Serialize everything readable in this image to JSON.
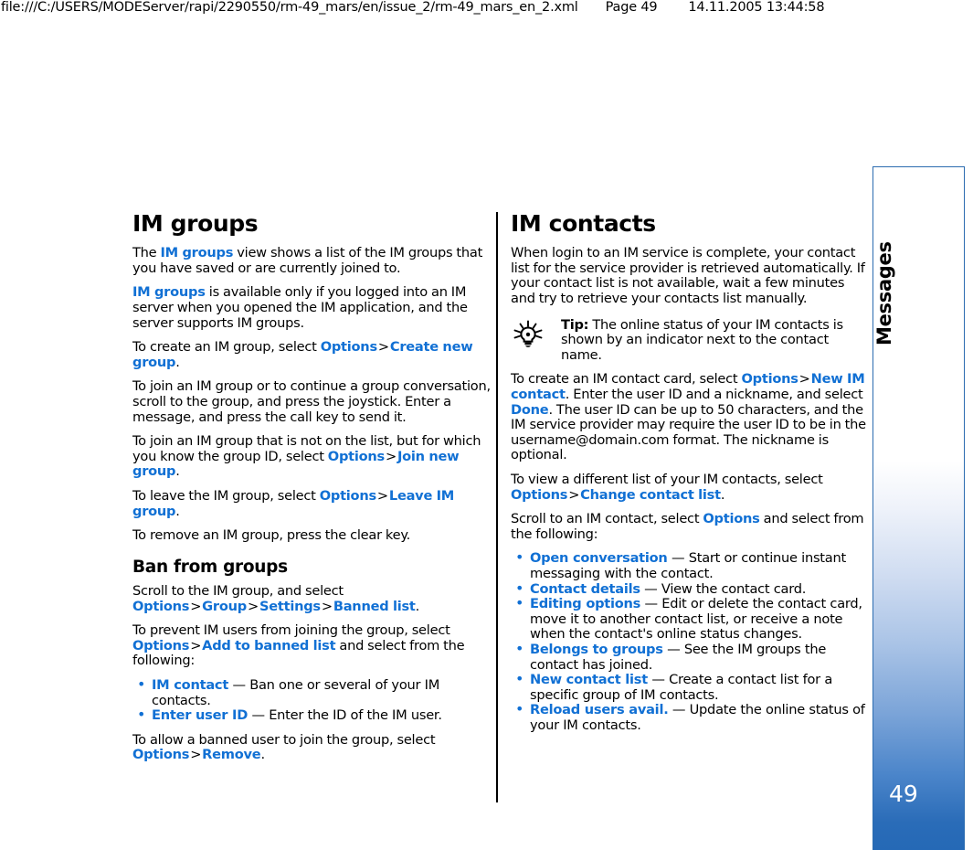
{
  "print_header": {
    "url": "file:///C:/USERS/MODEServer/rapi/2290550/rm-49_mars/en/issue_2/rm-49_mars_en_2.xml",
    "page_label": "Page 49",
    "datetime": "14.11.2005 13:44:58"
  },
  "side_tab": {
    "chapter": "Messages",
    "page_number": "49",
    "border_color": "#2c6cb0",
    "gradient_end_color": "#2569b6"
  },
  "colors": {
    "link": "#1170d4",
    "text": "#000000",
    "background": "#ffffff"
  },
  "left_column": {
    "heading": "IM groups",
    "p1": {
      "a": "The ",
      "link1": "IM groups",
      "b": " view shows a list of the IM groups that you have saved or are currently joined to."
    },
    "p2": {
      "link1": "IM groups",
      "b": " is available only if you logged into an IM server when you opened the IM application, and the server supports IM groups."
    },
    "p3": {
      "a": "To create an IM group, select ",
      "link1": "Options",
      "sep": ">",
      "link2": "Create new group",
      "tail": "."
    },
    "p4": "To join an IM group or to continue a group conversation, scroll to the group, and press the joystick. Enter a message, and press the call key to send it.",
    "p5": {
      "a": "To join an IM group that is not on the list, but for which you know the group ID, select ",
      "link1": "Options",
      "sep": ">",
      "link2": "Join new group",
      "tail": "."
    },
    "p6": {
      "a": "To leave the IM group, select ",
      "link1": "Options",
      "sep": ">",
      "link2": "Leave IM group",
      "tail": "."
    },
    "p7": "To remove an IM group, press the clear key.",
    "subheading": "Ban from groups",
    "p8": {
      "a": "Scroll to the IM group, and select ",
      "link1": "Options",
      "sep1": ">",
      "link2": "Group",
      "sep2": ">",
      "link3": "Settings",
      "sep3": ">",
      "link4": "Banned list",
      "tail": "."
    },
    "p9": {
      "a": "To prevent IM users from joining the group, select ",
      "link1": "Options",
      "sep": ">",
      "link2": "Add to banned list",
      "tail": " and select from the following:"
    },
    "bullets": [
      {
        "term": "IM contact",
        "dash": " — ",
        "desc": "Ban one or several of your IM contacts."
      },
      {
        "term": "Enter user ID",
        "dash": " — ",
        "desc": "Enter the ID of the IM user."
      }
    ],
    "p10": {
      "a": "To allow a banned user to join the group, select ",
      "link1": "Options",
      "sep": ">",
      "link2": "Remove",
      "tail": "."
    }
  },
  "right_column": {
    "heading": "IM contacts",
    "p1": "When login to an IM service is complete, your contact list for the service provider is retrieved automatically. If your contact list is not available, wait a few minutes and try to retrieve your contacts list manually.",
    "tip": {
      "icon": "lightbulb-icon",
      "label": "Tip:",
      "text": " The online status of your IM contacts is shown by an indicator next to the contact name."
    },
    "p2": {
      "a": "To create an IM contact card, select ",
      "link1": "Options",
      "sep": ">",
      "link2": "New IM contact",
      "b": ". Enter the user ID and a nickname, and select ",
      "link3": "Done",
      "c": ". The user ID can be up to 50 characters, and the IM service provider may require the user ID to be in the username@domain.com format. The nickname is optional."
    },
    "p3": {
      "a": "To view a different list of your IM contacts, select ",
      "link1": "Options",
      "sep": ">",
      "link2": "Change contact list",
      "tail": "."
    },
    "p4": {
      "a": "Scroll to an IM contact, select ",
      "link1": "Options",
      "b": " and select from the following:"
    },
    "bullets": [
      {
        "term": "Open conversation",
        "dash": " — ",
        "desc": "Start or continue instant messaging with the contact."
      },
      {
        "term": "Contact details",
        "dash": " — ",
        "desc": "View the contact card."
      },
      {
        "term": "Editing options",
        "dash": " — ",
        "desc": "Edit or delete the contact card, move it to another contact list, or receive a note when the contact's online status changes."
      },
      {
        "term": "Belongs to groups",
        "dash": " — ",
        "desc": "See the IM groups the contact has joined."
      },
      {
        "term": "New contact list",
        "dash": " — ",
        "desc": "Create a contact list for a specific group of IM contacts."
      },
      {
        "term": "Reload users avail.",
        "dash": " — ",
        "desc": "Update the online status of your IM contacts."
      }
    ]
  }
}
